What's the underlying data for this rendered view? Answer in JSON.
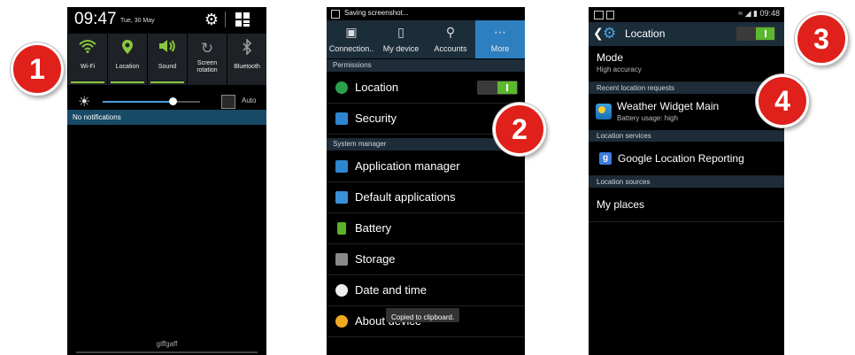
{
  "phone1": {
    "time": "09:47",
    "date": "Tue, 30 May",
    "quick_settings": [
      {
        "label": "Wi-Fi",
        "icon": "wifi-icon",
        "state": "on"
      },
      {
        "label": "Location",
        "icon": "location-pin-icon",
        "state": "on"
      },
      {
        "label": "Sound",
        "icon": "speaker-icon",
        "state": "on"
      },
      {
        "label": "Screen rotation",
        "icon": "rotate-icon",
        "state": "off"
      },
      {
        "label": "Bluetooth",
        "icon": "bluetooth-icon",
        "state": "off"
      }
    ],
    "brightness_level": 0.72,
    "auto_label": "Auto",
    "notifications_label": "No notifications",
    "carrier": "giffgaff"
  },
  "phone2": {
    "status_text": "Saving screenshot...",
    "tabs": [
      {
        "label": "Connection..",
        "icon": "connections-icon"
      },
      {
        "label": "My device",
        "icon": "device-icon"
      },
      {
        "label": "Accounts",
        "icon": "key-icon"
      },
      {
        "label": "More",
        "icon": "more-icon",
        "active": true
      }
    ],
    "sections": {
      "permissions": "Permissions",
      "system_manager": "System manager"
    },
    "items": {
      "location": "Location",
      "security": "Security",
      "application_manager": "Application manager",
      "default_applications": "Default applications",
      "battery": "Battery",
      "storage": "Storage",
      "date_time": "Date and time",
      "about_device": "About device"
    },
    "toast": "Copied to clipboard."
  },
  "phone3": {
    "time": "09:48",
    "title": "Location",
    "mode_title": "Mode",
    "mode_value": "High accuracy",
    "sections": {
      "recent": "Recent location requests",
      "services": "Location services",
      "sources": "Location sources"
    },
    "app_name": "Weather Widget Main",
    "app_battery": "Battery usage: high",
    "service_item": "Google Location Reporting",
    "source_item": "My places"
  },
  "badges": [
    "1",
    "2",
    "3",
    "4"
  ],
  "colors": {
    "accent_green": "#8cc63f",
    "toggle_green": "#5cb82f",
    "badge_red": "#e0201b",
    "tab_active": "#2e7fbf",
    "header_dark": "#1c2d3a"
  }
}
